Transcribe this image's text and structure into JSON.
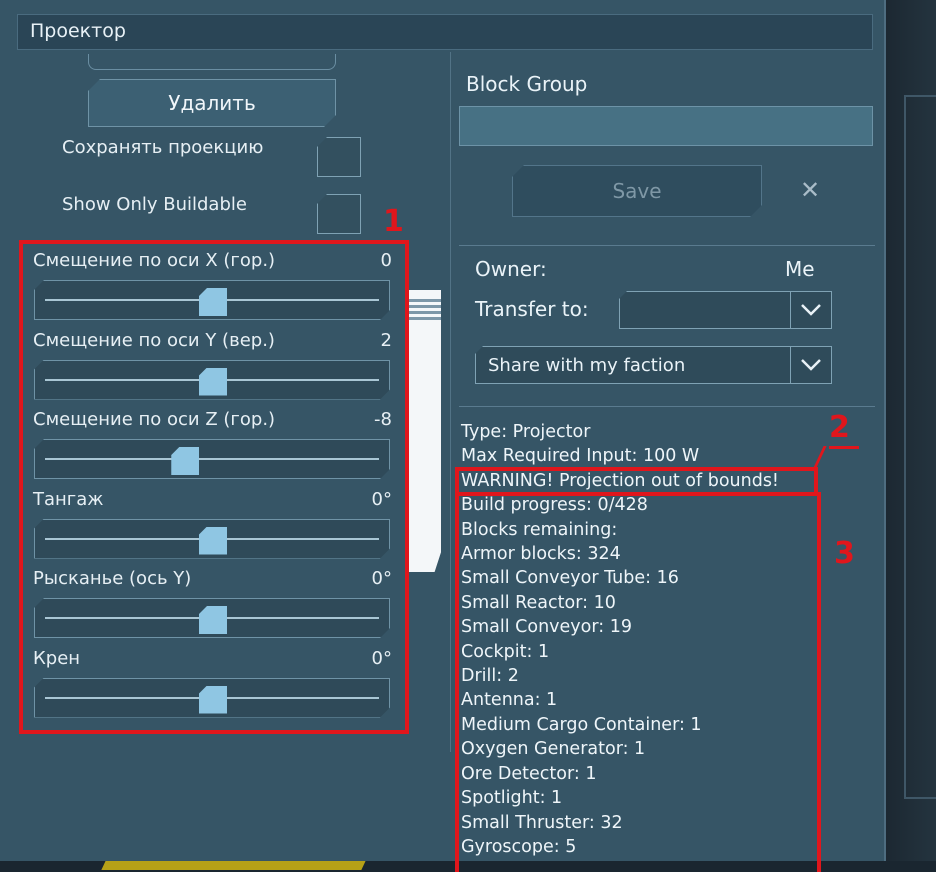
{
  "window": {
    "title": "Проектор"
  },
  "left": {
    "delete_label": "Удалить",
    "keep_projection_label": "Сохранять проекцию",
    "show_buildable_label": "Show Only Buildable",
    "sliders": [
      {
        "label": "Смещение по оси X (гор.)",
        "value": "0",
        "fill": 0.5
      },
      {
        "label": "Смещение по оси Y (вер.)",
        "value": "2",
        "fill": 0.5
      },
      {
        "label": "Смещение по оси Z (гор.)",
        "value": "-8",
        "fill": 0.41
      },
      {
        "label": "Тангаж",
        "value": "0°",
        "fill": 0.5
      },
      {
        "label": "Рысканье (ось Y)",
        "value": "0°",
        "fill": 0.5
      },
      {
        "label": "Крен",
        "value": "0°",
        "fill": 0.5
      }
    ]
  },
  "right": {
    "block_group_label": "Block Group",
    "save_label": "Save",
    "close_glyph": "✕",
    "owner_label": "Owner:",
    "owner_value": "Me",
    "transfer_label": "Transfer to:",
    "transfer_value": "",
    "share_value": "Share with my faction",
    "info_lines": [
      "Type: Projector",
      "Max Required Input: 100 W",
      "WARNING! Projection out of bounds!",
      "Build progress: 0/428",
      "Blocks remaining:",
      "Armor blocks: 324",
      "Small Conveyor Tube: 16",
      "Small Reactor: 10",
      "Small Conveyor: 19",
      "Cockpit: 1",
      "Drill: 2",
      "Antenna: 1",
      "Medium Cargo Container: 1",
      "Oxygen Generator: 1",
      "Ore Detector: 1",
      "Spotlight: 1",
      "Small Thruster: 32",
      "Gyroscope: 5"
    ]
  },
  "annotations": {
    "one": "1",
    "two": "2",
    "three": "3"
  },
  "colors": {
    "annotation": "#e0161c",
    "panel": "#365566",
    "knob": "#8fc6e3"
  }
}
